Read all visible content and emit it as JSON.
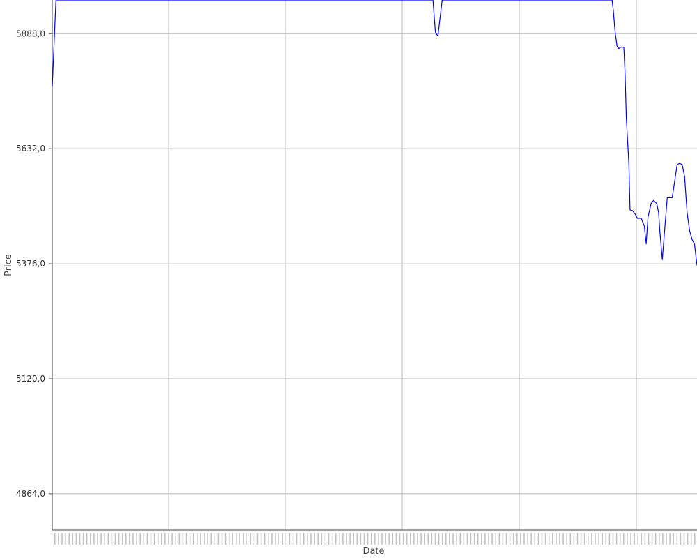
{
  "chart_data": {
    "type": "line",
    "title": "",
    "xlabel": "Date",
    "ylabel": "Price",
    "yticks": [
      "4864,0",
      "5120,0",
      "5376,0",
      "5632,0",
      "5888,0"
    ],
    "ytick_values": [
      4864,
      5120,
      5376,
      5632,
      5888
    ],
    "ylim": [
      4783,
      5963
    ],
    "grid": true,
    "legend": "none",
    "series": [
      {
        "color": "#0000ff",
        "points": [
          [
            0.0,
            5770
          ],
          [
            0.6,
            5963
          ],
          [
            61.4,
            5963
          ],
          [
            61.8,
            5890
          ],
          [
            62.2,
            5883
          ],
          [
            62.6,
            5930
          ],
          [
            62.9,
            5963
          ],
          [
            90.3,
            5963
          ],
          [
            90.5,
            5940
          ],
          [
            90.8,
            5890
          ],
          [
            91.1,
            5860
          ],
          [
            91.4,
            5855
          ],
          [
            91.7,
            5858
          ],
          [
            92.2,
            5858
          ],
          [
            92.4,
            5800
          ],
          [
            92.6,
            5700
          ],
          [
            93.0,
            5600
          ],
          [
            93.2,
            5496
          ],
          [
            93.6,
            5494
          ],
          [
            94.0,
            5487
          ],
          [
            94.4,
            5477
          ],
          [
            95.0,
            5477
          ],
          [
            95.5,
            5460
          ],
          [
            95.8,
            5420
          ],
          [
            96.1,
            5480
          ],
          [
            96.6,
            5510
          ],
          [
            97.0,
            5517
          ],
          [
            97.5,
            5510
          ],
          [
            97.8,
            5490
          ],
          [
            98.0,
            5450
          ],
          [
            98.4,
            5385
          ],
          [
            98.8,
            5455
          ],
          [
            99.2,
            5523
          ],
          [
            99.6,
            5523
          ],
          [
            100.0,
            5523
          ],
          [
            100.4,
            5560
          ],
          [
            100.8,
            5597
          ],
          [
            101.2,
            5599
          ],
          [
            101.6,
            5597
          ],
          [
            102.0,
            5570
          ],
          [
            102.4,
            5490
          ],
          [
            102.8,
            5450
          ],
          [
            103.2,
            5430
          ],
          [
            103.6,
            5420
          ],
          [
            104.0,
            5372
          ]
        ]
      }
    ]
  }
}
